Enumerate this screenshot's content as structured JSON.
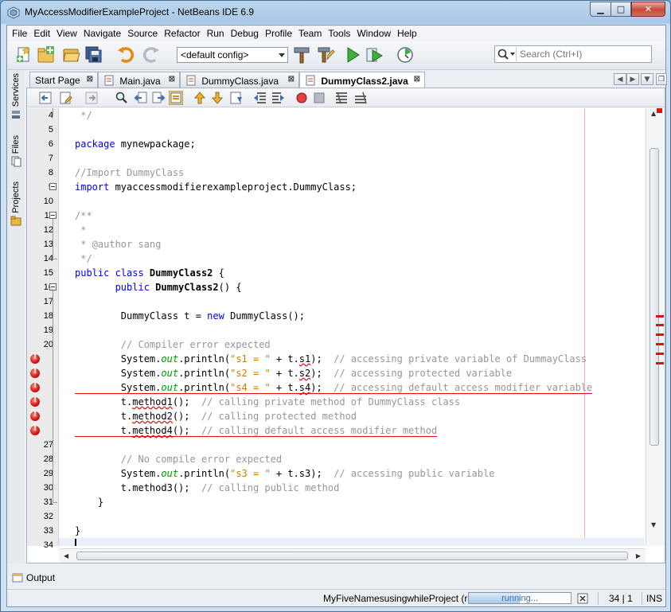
{
  "window": {
    "title": "MyAccessModifierExampleProject - NetBeans IDE 6.9",
    "minimize_glyph": "▁",
    "maximize_glyph": "□",
    "close_glyph": "✕"
  },
  "menu": [
    "File",
    "Edit",
    "View",
    "Navigate",
    "Source",
    "Refactor",
    "Run",
    "Debug",
    "Profile",
    "Team",
    "Tools",
    "Window",
    "Help"
  ],
  "toolbar": {
    "config_value": "<default config>",
    "search_placeholder": "Search (Ctrl+I)",
    "icons": [
      "new-file-icon",
      "new-project-icon",
      "open-project-icon",
      "save-all-icon",
      "undo-icon",
      "redo-icon",
      "build-icon",
      "clean-build-icon",
      "run-icon",
      "debug-icon",
      "profile-icon"
    ]
  },
  "sidebar": {
    "tabs": [
      "Services",
      "Files",
      "Projects"
    ]
  },
  "tabs": [
    {
      "label": "Start Page",
      "icon": "none"
    },
    {
      "label": "Main.java",
      "icon": "java-file-icon"
    },
    {
      "label": "DummyClass.java",
      "icon": "java-file-icon"
    },
    {
      "label": "DummyClass2.java",
      "icon": "java-file-icon",
      "active": true
    }
  ],
  "tab_close_glyph": "⊠",
  "editor": {
    "margin_color": "#f0b4b4",
    "error_color": "#e01010",
    "lines": [
      {
        "n": "4",
        "segs": [
          {
            "t": " */",
            "c": "cm"
          }
        ]
      },
      {
        "n": "5",
        "segs": []
      },
      {
        "n": "6",
        "segs": [
          {
            "t": "package",
            "c": "kw"
          },
          {
            "t": " mynewpackage;",
            "c": ""
          }
        ]
      },
      {
        "n": "7",
        "segs": []
      },
      {
        "n": "8",
        "segs": [
          {
            "t": "//Import DummyClass",
            "c": "cm"
          }
        ]
      },
      {
        "n": "9",
        "segs": [
          {
            "t": "import",
            "c": "kw"
          },
          {
            "t": " myaccessmodifierexampleproject.DummyClass;",
            "c": ""
          }
        ]
      },
      {
        "n": "10",
        "segs": []
      },
      {
        "n": "11",
        "segs": [
          {
            "t": "/**",
            "c": "cm"
          }
        ]
      },
      {
        "n": "12",
        "segs": [
          {
            "t": " *",
            "c": "cm"
          }
        ]
      },
      {
        "n": "13",
        "segs": [
          {
            "t": " * @author sang",
            "c": "cm"
          }
        ]
      },
      {
        "n": "14",
        "segs": [
          {
            "t": " */",
            "c": "cm"
          }
        ]
      },
      {
        "n": "15",
        "segs": [
          {
            "t": "public class ",
            "c": "kw"
          },
          {
            "t": "DummyClass2",
            "c": "bold"
          },
          {
            "t": " {",
            "c": ""
          }
        ]
      },
      {
        "n": "16",
        "segs": [
          {
            "t": "       ",
            "c": ""
          },
          {
            "t": "public ",
            "c": "kw"
          },
          {
            "t": "DummyClass2",
            "c": "bold"
          },
          {
            "t": "() {",
            "c": ""
          }
        ]
      },
      {
        "n": "17",
        "segs": []
      },
      {
        "n": "18",
        "segs": [
          {
            "t": "        DummyClass t = ",
            "c": ""
          },
          {
            "t": "new",
            "c": "kw"
          },
          {
            "t": " DummyClass();",
            "c": ""
          }
        ]
      },
      {
        "n": "19",
        "segs": []
      },
      {
        "n": "20",
        "segs": [
          {
            "t": "        // Compiler error expected",
            "c": "cm"
          }
        ]
      },
      {
        "n": "",
        "error": true,
        "segs": [
          {
            "t": "        System.",
            "c": ""
          },
          {
            "t": "out",
            "c": "fld"
          },
          {
            "t": ".println(",
            "c": ""
          },
          {
            "t": "\"s1 = \"",
            "c": "st"
          },
          {
            "t": " + t.",
            "c": ""
          },
          {
            "t": "s1",
            "c": "err"
          },
          {
            "t": ");  ",
            "c": ""
          },
          {
            "t": "// accessing private variable of DummayClass",
            "c": "cm"
          }
        ]
      },
      {
        "n": "",
        "error": true,
        "segs": [
          {
            "t": "        System.",
            "c": ""
          },
          {
            "t": "out",
            "c": "fld"
          },
          {
            "t": ".println(",
            "c": ""
          },
          {
            "t": "\"s2 = \"",
            "c": "st"
          },
          {
            "t": " + t.",
            "c": ""
          },
          {
            "t": "s2",
            "c": "err"
          },
          {
            "t": ");  ",
            "c": ""
          },
          {
            "t": "// accessing protected variable",
            "c": "cm"
          }
        ]
      },
      {
        "n": "",
        "error": true,
        "underline": true,
        "segs": [
          {
            "t": "        System.",
            "c": ""
          },
          {
            "t": "out",
            "c": "fld"
          },
          {
            "t": ".println(",
            "c": ""
          },
          {
            "t": "\"s4 = \"",
            "c": "st"
          },
          {
            "t": " + t.",
            "c": ""
          },
          {
            "t": "s4",
            "c": "err"
          },
          {
            "t": ");  ",
            "c": ""
          },
          {
            "t": "// accessing default access modifier variable",
            "c": "cm"
          }
        ]
      },
      {
        "n": "",
        "error": true,
        "segs": [
          {
            "t": "        t.",
            "c": ""
          },
          {
            "t": "method1",
            "c": "err"
          },
          {
            "t": "();  ",
            "c": ""
          },
          {
            "t": "// calling private method of DummyClass class",
            "c": "cm"
          }
        ]
      },
      {
        "n": "",
        "error": true,
        "segs": [
          {
            "t": "        t.",
            "c": ""
          },
          {
            "t": "method2",
            "c": "err"
          },
          {
            "t": "();  ",
            "c": ""
          },
          {
            "t": "// calling protected method",
            "c": "cm"
          }
        ]
      },
      {
        "n": "",
        "error": true,
        "underline": true,
        "segs": [
          {
            "t": "        t.",
            "c": ""
          },
          {
            "t": "method4",
            "c": "err"
          },
          {
            "t": "();  ",
            "c": ""
          },
          {
            "t": "// calling default access modifier method",
            "c": "cm"
          }
        ]
      },
      {
        "n": "27",
        "segs": []
      },
      {
        "n": "28",
        "segs": [
          {
            "t": "        // No compile error expected",
            "c": "cm"
          }
        ]
      },
      {
        "n": "29",
        "segs": [
          {
            "t": "        System.",
            "c": ""
          },
          {
            "t": "out",
            "c": "fld"
          },
          {
            "t": ".println(",
            "c": ""
          },
          {
            "t": "\"s3 = \"",
            "c": "st"
          },
          {
            "t": " + t.s3);  ",
            "c": ""
          },
          {
            "t": "// accessing public variable",
            "c": "cm"
          }
        ]
      },
      {
        "n": "30",
        "segs": [
          {
            "t": "        t.method3();  ",
            "c": ""
          },
          {
            "t": "// calling public method",
            "c": "cm"
          }
        ]
      },
      {
        "n": "31",
        "segs": [
          {
            "t": "    }",
            "c": ""
          }
        ]
      },
      {
        "n": "32",
        "segs": []
      },
      {
        "n": "33",
        "segs": [
          {
            "t": "}",
            "c": ""
          }
        ]
      },
      {
        "n": "34",
        "segs": [],
        "current": true
      }
    ]
  },
  "output": {
    "label": "Output"
  },
  "status": {
    "run_label": "MyFiveNamesusingwhileProject (run)",
    "progress_text": "running...",
    "progress_fraction": 0.5,
    "position": "34 | 1",
    "mode": "INS"
  }
}
